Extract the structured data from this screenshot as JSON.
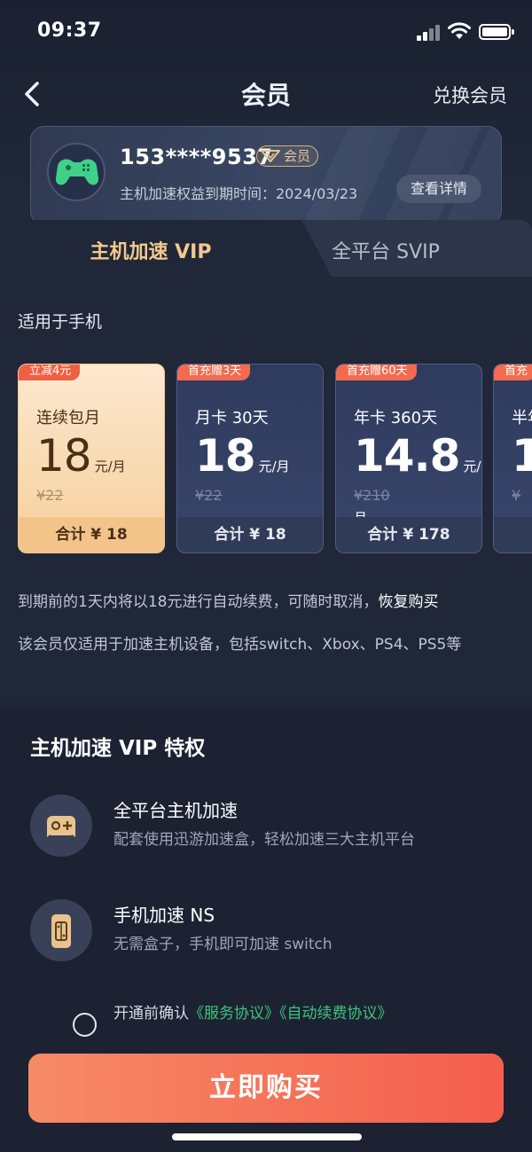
{
  "status": {
    "time": "09:37"
  },
  "nav": {
    "title": "会员",
    "right": "兑换会员"
  },
  "member": {
    "phone": "153****9537",
    "badge": "会员",
    "expiry": "主机加速权益到期时间：2024/03/23",
    "detail_button": "查看详情"
  },
  "tabs": [
    {
      "label": "主机加速 VIP",
      "active": true
    },
    {
      "label": "全平台 SVIP",
      "active": false
    }
  ],
  "section_hint": "适用于手机",
  "plans": [
    {
      "tag": "立减4元",
      "name": "连续包月",
      "price": "18",
      "unit": "元/月",
      "orig": "¥22",
      "total": "合计 ¥ 18",
      "selected": true
    },
    {
      "tag": "首充赠3天",
      "name": "月卡 30天",
      "price": "18",
      "unit": "元/月",
      "orig": "¥22",
      "total": "合计 ¥ 18",
      "selected": false
    },
    {
      "tag": "首充赠60天",
      "name": "年卡 360天",
      "price": "14.8",
      "unit": "元/月",
      "orig": "¥210",
      "total": "合计 ¥ 178",
      "selected": false
    },
    {
      "tag": "首充",
      "name": "半年",
      "price": "1",
      "unit": "",
      "orig": "¥",
      "total": "",
      "selected": false
    }
  ],
  "notes": {
    "renew_prefix": "到期前的1天内将以18元进行自动续费，可随时取消，",
    "restore_link": "恢复购买",
    "scope": "该会员仅适用于加速主机设备，包括switch、Xbox、PS4、PS5等"
  },
  "privileges": {
    "title": "主机加速 VIP 特权",
    "items": [
      {
        "name": "全平台主机加速",
        "desc": "配套使用迅游加速盒，轻松加速三大主机平台",
        "icon": "gamepad-icon"
      },
      {
        "name": "手机加速 NS",
        "desc": "无需盒子，手机即可加速 switch",
        "icon": "phone-switch-icon"
      }
    ]
  },
  "agreement": {
    "prefix": "开通前确认",
    "link1": "《服务协议》",
    "link2": "《自动续费协议》"
  },
  "buy_button": "立即购买",
  "colors": {
    "accent_gold": "#f3c98d",
    "buy_button": "#f45e4d",
    "link_green": "#3ec47a",
    "tag_red": "#f26b4e"
  }
}
